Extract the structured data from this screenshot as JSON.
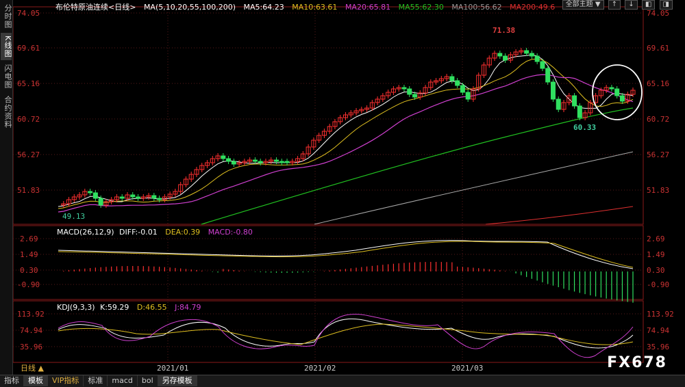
{
  "sidebar": {
    "tabs": [
      {
        "label": "分时图",
        "active": false
      },
      {
        "label": "K线图",
        "active": true
      },
      {
        "label": "闪电图",
        "active": false
      },
      {
        "label": "合约资料",
        "active": false
      }
    ]
  },
  "header": {
    "title": "布伦特原油连续<日线>",
    "ma_title": "MA(5,10,20,55,100,200)",
    "ma_values": [
      {
        "label": "MA5:64.23",
        "color": "#ffffff"
      },
      {
        "label": "MA10:63.61",
        "color": "#e0c020"
      },
      {
        "label": "MA20:65.81",
        "color": "#d040d0"
      },
      {
        "label": "MA55:62.30",
        "color": "#20c020"
      },
      {
        "label": "MA100:56.62",
        "color": "#999999"
      },
      {
        "label": "MA200:49.6",
        "color": "#e03030"
      }
    ]
  },
  "toolbar": {
    "main_select": "全部主题",
    "buttons": [
      "↑",
      "↓",
      "◧",
      "◨"
    ]
  },
  "price_axis": {
    "ticks": [
      "74.05",
      "69.61",
      "65.16",
      "60.72",
      "56.27",
      "51.83"
    ],
    "high_label": "71.38",
    "low_label": "60.33",
    "start_low_label": "49.13"
  },
  "macd": {
    "title": "MACD(26,12,9)",
    "diff": "DIFF:-0.01",
    "dea": "DEA:0.39",
    "macd": "MACD:-0.80",
    "ticks": [
      "2.69",
      "1.49",
      "0.30",
      "-0.90"
    ]
  },
  "kdj": {
    "title": "KDJ(9,3,3)",
    "k": "K:59.29",
    "d": "D:46.55",
    "j": "J:84.79",
    "ticks": [
      "113.92",
      "74.94",
      "35.96"
    ]
  },
  "dates": [
    "2021/01",
    "2021/02",
    "2021/03"
  ],
  "period": "日线 ▲",
  "bottom_tabs": [
    {
      "label": "指标",
      "active": false,
      "vip": false
    },
    {
      "label": "模板",
      "active": true,
      "vip": false
    },
    {
      "label": "VIP指标",
      "active": false,
      "vip": true
    },
    {
      "label": "标准",
      "active": false,
      "vip": false
    },
    {
      "label": "macd",
      "active": false,
      "vip": false
    },
    {
      "label": "bol",
      "active": false,
      "vip": false
    },
    {
      "label": "另存模板",
      "active": true,
      "vip": false
    }
  ],
  "watermark": "FX678"
}
